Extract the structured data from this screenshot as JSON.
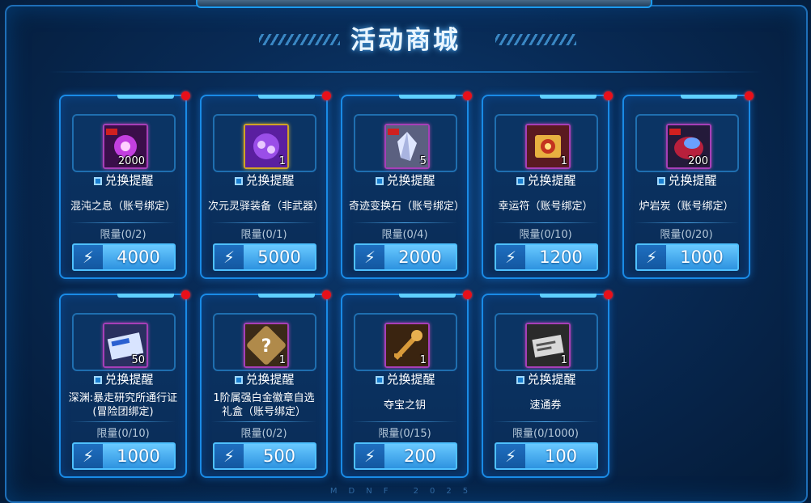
{
  "title": "活动商城",
  "remind_label": "兑换提醒",
  "footer": "MDNF 2025",
  "items": [
    {
      "name": "混沌之息（账号绑定）",
      "qty": "2000",
      "limit": "限量(0/2)",
      "price": "4000",
      "icon": "chaos-breath-icon"
    },
    {
      "name": "次元灵驿装备（非武器）",
      "qty": "1",
      "limit": "限量(0/1)",
      "price": "5000",
      "icon": "dimension-gear-icon"
    },
    {
      "name": "奇迹变换石（账号绑定）",
      "qty": "5",
      "limit": "限量(0/4)",
      "price": "2000",
      "icon": "crystal-icon"
    },
    {
      "name": "幸运符（账号绑定）",
      "qty": "1",
      "limit": "限量(0/10)",
      "price": "1200",
      "icon": "lucky-charm-icon"
    },
    {
      "name": "炉岩炭（账号绑定）",
      "qty": "200",
      "limit": "限量(0/20)",
      "price": "1000",
      "icon": "furnace-coal-icon"
    },
    {
      "name": "深渊:暴走研究所通行证(冒险团绑定)",
      "qty": "50",
      "limit": "限量(0/10)",
      "price": "1000",
      "icon": "pass-ticket-icon"
    },
    {
      "name": "1阶属强白金徽章自选礼盒（账号绑定）",
      "qty": "1",
      "limit": "限量(0/2)",
      "price": "500",
      "icon": "mystery-box-icon"
    },
    {
      "name": "夺宝之钥",
      "qty": "1",
      "limit": "限量(0/15)",
      "price": "200",
      "icon": "treasure-key-icon"
    },
    {
      "name": "速通券",
      "qty": "1",
      "limit": "限量(0/1000)",
      "price": "100",
      "icon": "speed-ticket-icon"
    }
  ]
}
